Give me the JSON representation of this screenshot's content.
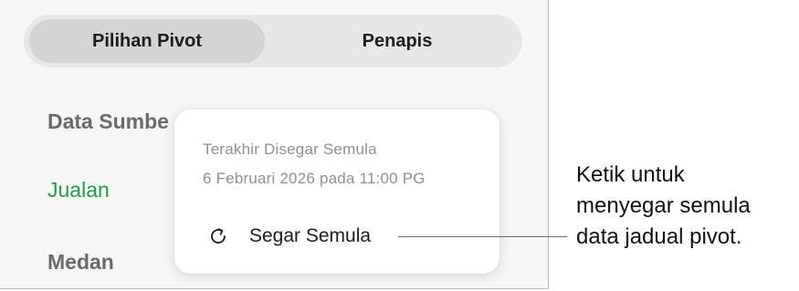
{
  "tabs": {
    "active_label": "Pilihan Pivot",
    "inactive_label": "Penapis"
  },
  "sections": {
    "source_title": "Data Sumbe",
    "source_value": "Jualan",
    "fields_title": "Medan"
  },
  "popover": {
    "last_refreshed_label": "Terakhir Disegar Semula",
    "last_refreshed_value": "6 Februari 2026 pada 11:00 PG",
    "refresh_button_label": "Segar Semula"
  },
  "callout": {
    "line1": "Ketik untuk",
    "line2": "menyegar semula",
    "line3": "data jadual pivot."
  },
  "colors": {
    "accent_green": "#1e9e4a",
    "panel_background": "#f6f6f6"
  },
  "icons": {
    "refresh": "refresh-icon"
  }
}
